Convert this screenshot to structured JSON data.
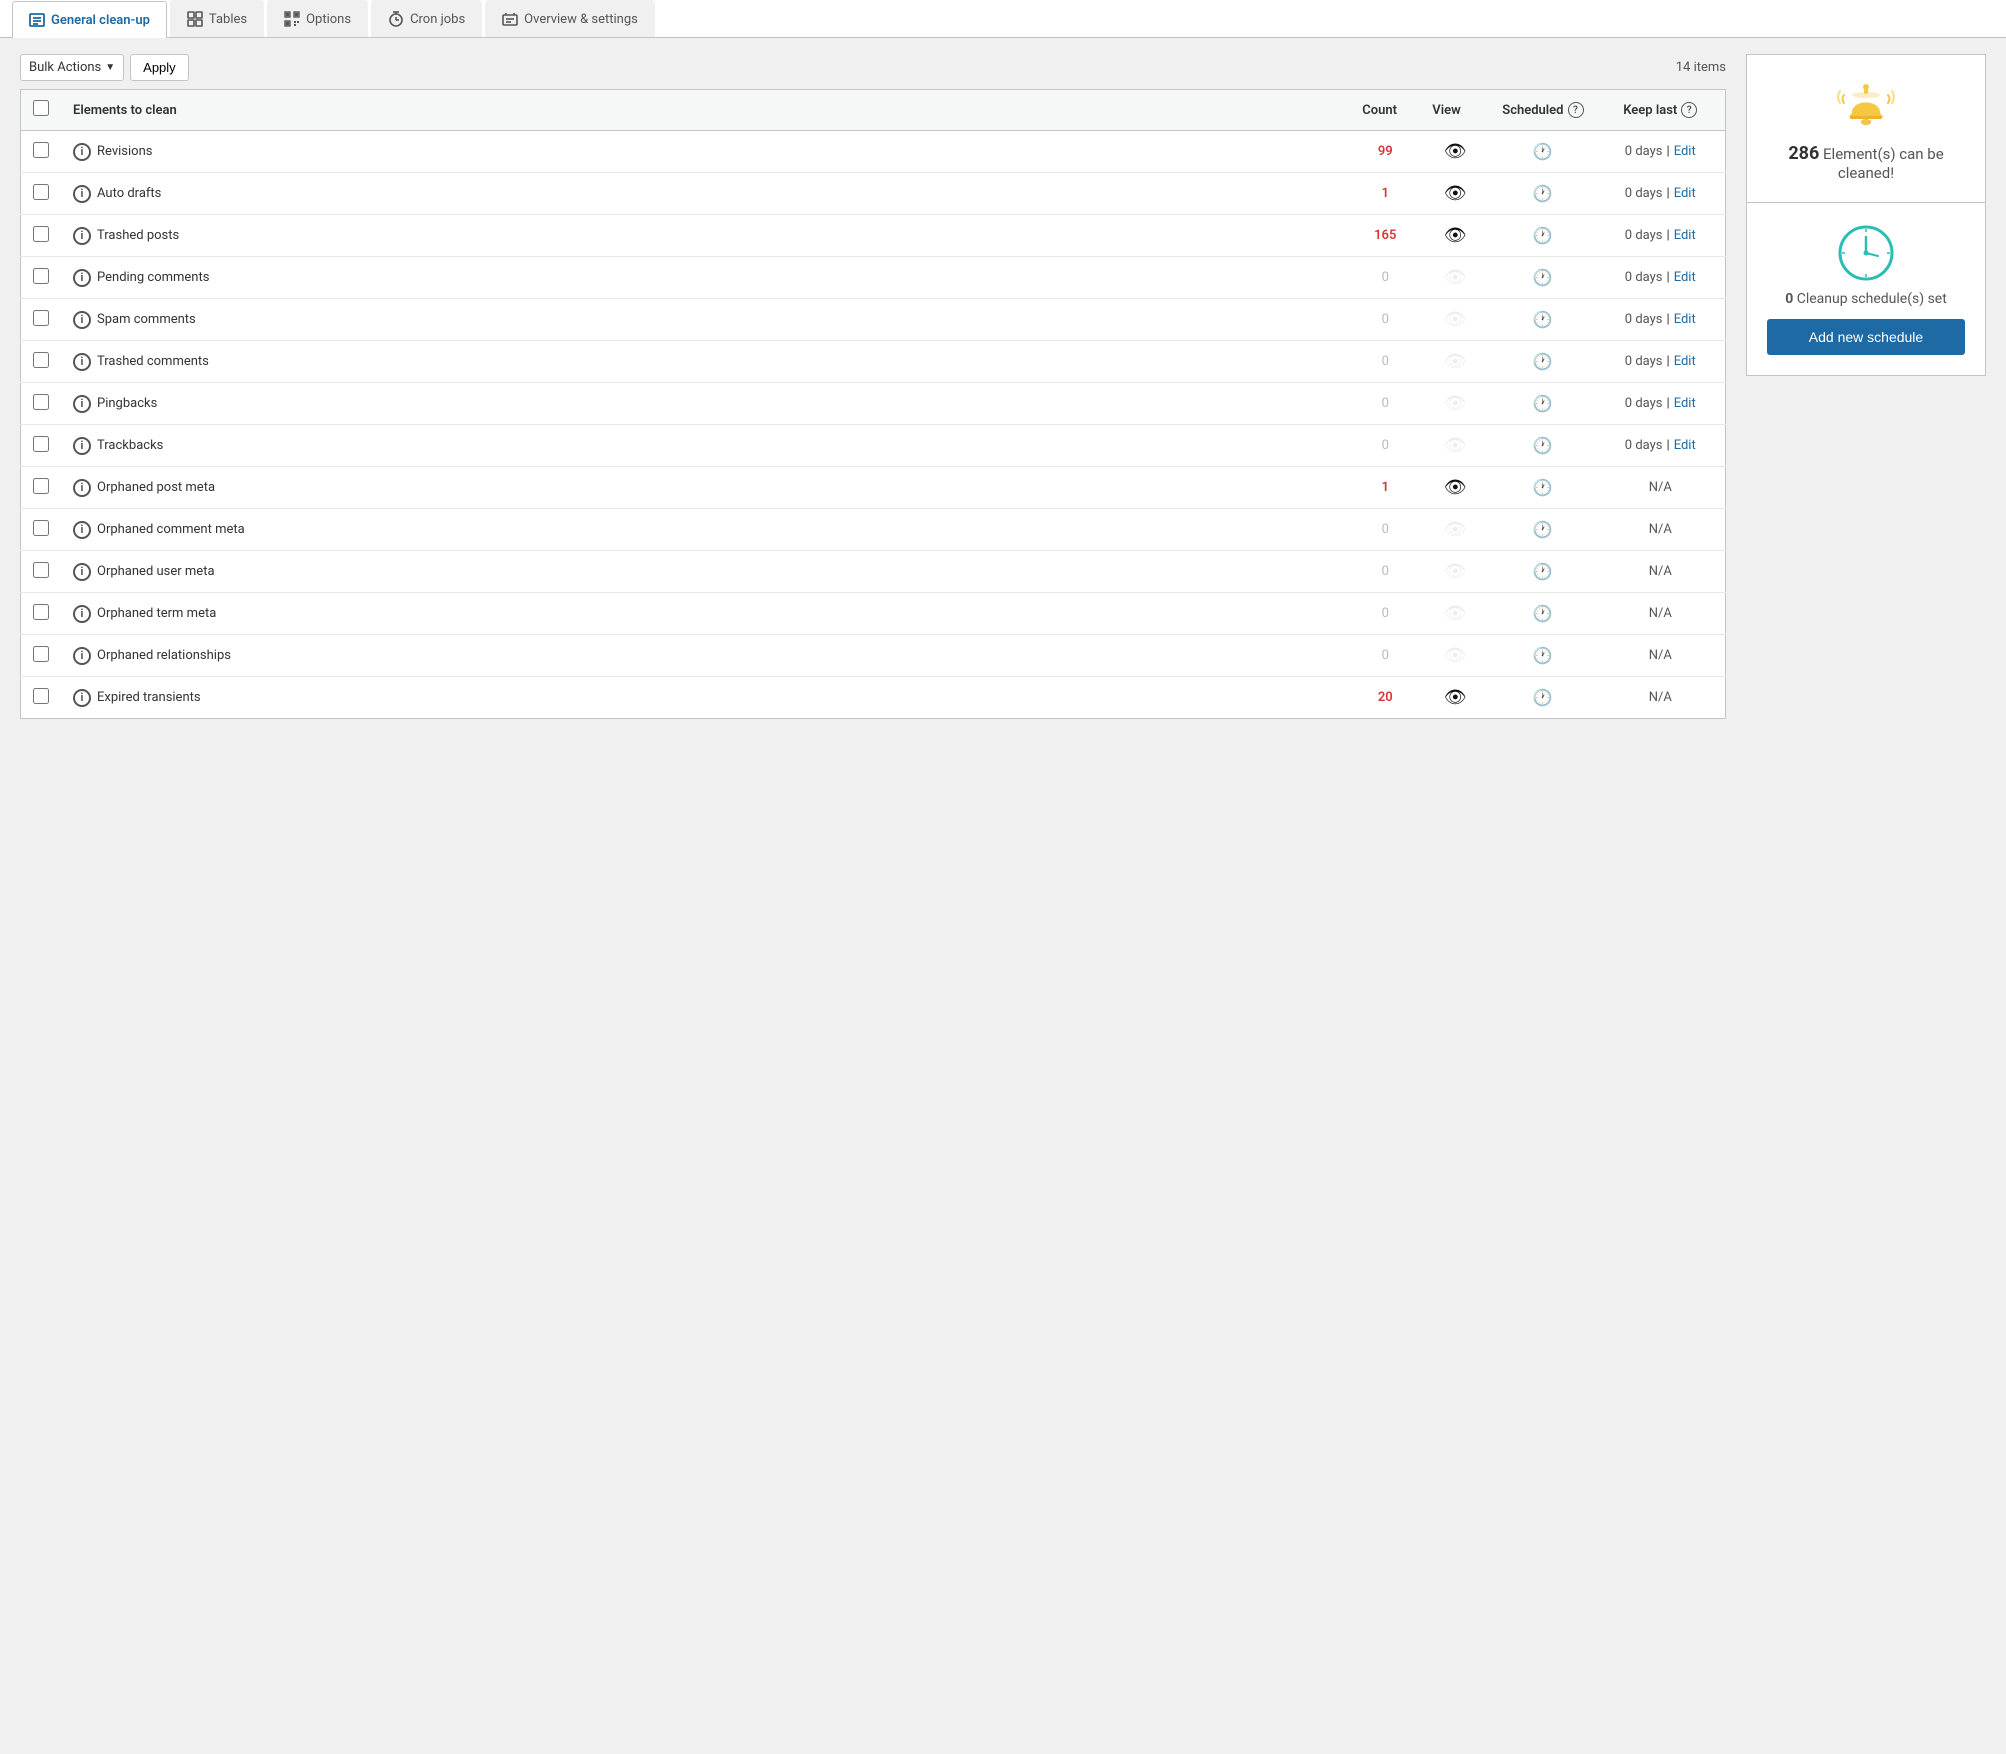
{
  "tabs": [
    {
      "id": "general-cleanup",
      "label": "General clean-up",
      "active": true,
      "icon": "list-icon"
    },
    {
      "id": "tables",
      "label": "Tables",
      "active": false,
      "icon": "grid-icon"
    },
    {
      "id": "options",
      "label": "Options",
      "active": false,
      "icon": "qr-icon"
    },
    {
      "id": "cron-jobs",
      "label": "Cron jobs",
      "active": false,
      "icon": "clock-icon"
    },
    {
      "id": "overview-settings",
      "label": "Overview & settings",
      "active": false,
      "icon": "settings-icon"
    }
  ],
  "toolbar": {
    "bulk_actions_label": "Bulk Actions",
    "apply_label": "Apply",
    "item_count": "14 items"
  },
  "table": {
    "headers": {
      "elements": "Elements to clean",
      "count": "Count",
      "view": "View",
      "scheduled": "Scheduled",
      "keep_last": "Keep last"
    },
    "rows": [
      {
        "name": "Revisions",
        "count": "99",
        "count_type": "red",
        "view": "active",
        "scheduled": false,
        "keep": "days",
        "keep_value": "0",
        "na": false
      },
      {
        "name": "Auto drafts",
        "count": "1",
        "count_type": "red",
        "view": "active",
        "scheduled": false,
        "keep": "days",
        "keep_value": "0",
        "na": false
      },
      {
        "name": "Trashed posts",
        "count": "165",
        "count_type": "red",
        "view": "active",
        "scheduled": false,
        "keep": "days",
        "keep_value": "0",
        "na": false
      },
      {
        "name": "Pending comments",
        "count": "0",
        "count_type": "zero",
        "view": "inactive",
        "scheduled": false,
        "keep": "days",
        "keep_value": "0",
        "na": false
      },
      {
        "name": "Spam comments",
        "count": "0",
        "count_type": "zero",
        "view": "inactive",
        "scheduled": false,
        "keep": "days",
        "keep_value": "0",
        "na": false
      },
      {
        "name": "Trashed comments",
        "count": "0",
        "count_type": "zero",
        "view": "inactive",
        "scheduled": false,
        "keep": "days",
        "keep_value": "0",
        "na": false
      },
      {
        "name": "Pingbacks",
        "count": "0",
        "count_type": "zero",
        "view": "inactive",
        "scheduled": false,
        "keep": "days",
        "keep_value": "0",
        "na": false
      },
      {
        "name": "Trackbacks",
        "count": "0",
        "count_type": "zero",
        "view": "inactive",
        "scheduled": false,
        "keep": "days",
        "keep_value": "0",
        "na": false
      },
      {
        "name": "Orphaned post meta",
        "count": "1",
        "count_type": "red",
        "view": "active",
        "scheduled": false,
        "keep": "na",
        "keep_value": "",
        "na": true
      },
      {
        "name": "Orphaned comment meta",
        "count": "0",
        "count_type": "zero",
        "view": "inactive",
        "scheduled": false,
        "keep": "na",
        "keep_value": "",
        "na": true
      },
      {
        "name": "Orphaned user meta",
        "count": "0",
        "count_type": "zero",
        "view": "inactive",
        "scheduled": false,
        "keep": "na",
        "keep_value": "",
        "na": true
      },
      {
        "name": "Orphaned term meta",
        "count": "0",
        "count_type": "zero",
        "view": "inactive",
        "scheduled": false,
        "keep": "na",
        "keep_value": "",
        "na": true
      },
      {
        "name": "Orphaned relationships",
        "count": "0",
        "count_type": "zero",
        "view": "inactive",
        "scheduled": false,
        "keep": "na",
        "keep_value": "",
        "na": true
      },
      {
        "name": "Expired transients",
        "count": "20",
        "count_type": "red",
        "view": "active",
        "scheduled": false,
        "keep": "na",
        "keep_value": "",
        "na": true
      }
    ],
    "edit_label": "Edit",
    "days_label": "days",
    "separator": "|",
    "na_label": "N/A"
  },
  "sidebar": {
    "alert_count": "286",
    "alert_text": "Element(s) can be cleaned!",
    "schedule_count": "0",
    "schedule_text": "Cleanup schedule(s) set",
    "add_schedule_label": "Add new schedule"
  }
}
